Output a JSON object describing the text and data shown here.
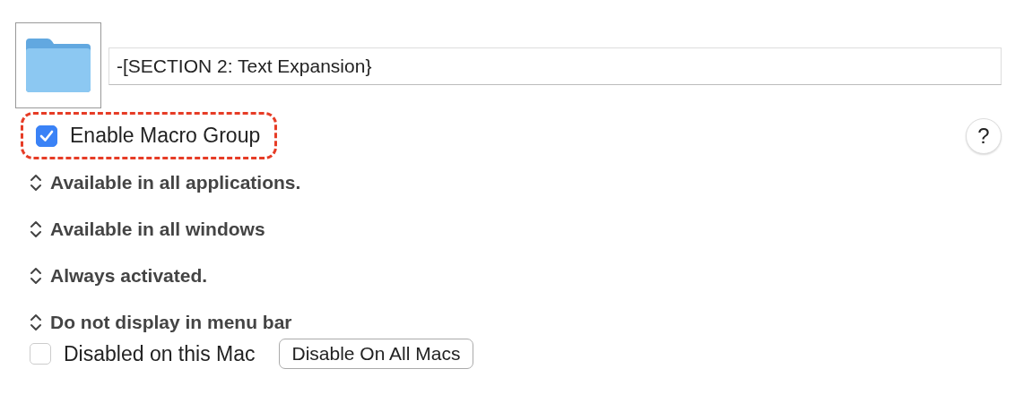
{
  "group_name": {
    "value": "-[SECTION 2: Text Expansion}"
  },
  "enable": {
    "label": "Enable Macro Group",
    "checked": true,
    "highlighted": true
  },
  "help_button": {
    "label": "?"
  },
  "popups": [
    {
      "label": "Available in all applications."
    },
    {
      "label": "Available in all windows"
    },
    {
      "label": "Always activated."
    },
    {
      "label": "Do not display in menu bar"
    }
  ],
  "disabled_here": {
    "label": "Disabled on this Mac",
    "checked": false
  },
  "disable_all_button": {
    "label": "Disable On All Macs"
  }
}
